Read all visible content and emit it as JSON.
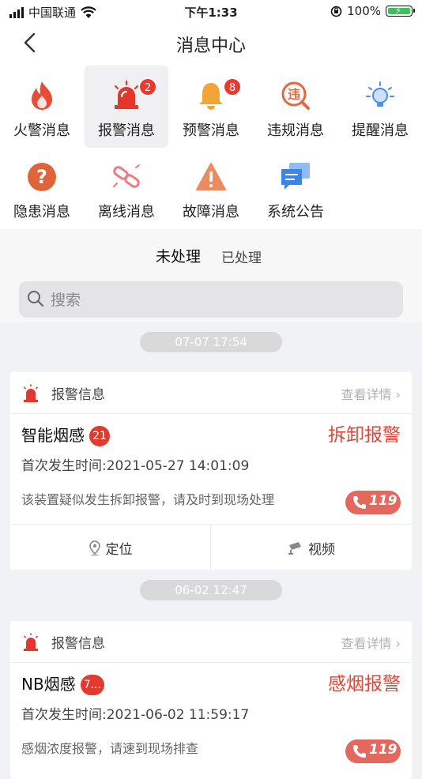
{
  "status_bar": {
    "carrier": "中国联通",
    "time": "下午1:33",
    "battery": "100%"
  },
  "header": {
    "title": "消息中心"
  },
  "categories": [
    {
      "label": "火警消息",
      "icon": "fire-icon"
    },
    {
      "label": "报警消息",
      "icon": "siren-icon",
      "badge": "2",
      "active": true
    },
    {
      "label": "预警消息",
      "icon": "bell-icon",
      "badge": "8"
    },
    {
      "label": "违规消息",
      "icon": "violation-icon"
    },
    {
      "label": "提醒消息",
      "icon": "lightbulb-icon"
    },
    {
      "label": "隐患消息",
      "icon": "question-icon"
    },
    {
      "label": "离线消息",
      "icon": "broken-link-icon"
    },
    {
      "label": "故障消息",
      "icon": "warning-icon"
    },
    {
      "label": "系统公告",
      "icon": "chat-icon"
    }
  ],
  "tabs": [
    {
      "label": "未处理",
      "active": true
    },
    {
      "label": "已处理"
    }
  ],
  "search": {
    "placeholder": "搜索"
  },
  "messages": [
    {
      "date": "07-07 17:54",
      "header_title": "报警信息",
      "detail_link": "查看详情",
      "device": "智能烟感",
      "count": "21",
      "alarm_type": "拆卸报警",
      "first_time": "首次发生时间:2021-05-27 14:01:09",
      "description": "该装置疑似发生拆卸报警，请及时到现场处理",
      "call_label": "119",
      "locate_label": "定位",
      "video_label": "视频"
    },
    {
      "date": "06-02 12:47",
      "header_title": "报警信息",
      "detail_link": "查看详情",
      "device": "NB烟感",
      "count": "7...",
      "alarm_type": "感烟报警",
      "first_time": "首次发生时间:2021-06-02 11:59:17",
      "description": "感烟浓度报警，请速到现场排查",
      "call_label": "119"
    }
  ],
  "colors": {
    "alarm_red": "#e0463a",
    "badge_red": "#e93a2f",
    "call_button": "#e4685d"
  }
}
